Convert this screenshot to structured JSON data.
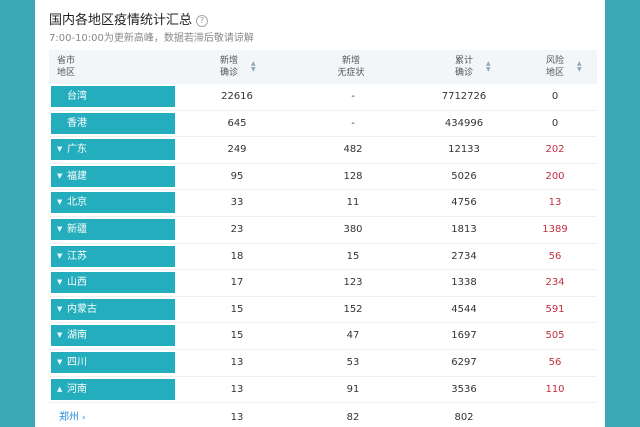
{
  "title": "国内各地区疫情统计汇总",
  "subtitle": "7:00-10:00为更新高峰，数据若滞后敬请谅解",
  "headers": {
    "region": "省市\n地区",
    "new_confirmed": "新增\n确诊",
    "new_asymptomatic": "新增\n无症状",
    "total_confirmed": "累计\n确诊",
    "risk": "风险\n地区"
  },
  "rows": [
    {
      "name": "台湾",
      "expand": "",
      "new_confirmed": "22616",
      "new_asymptomatic": "-",
      "total": "7712726",
      "risk": "0",
      "risk_alert": false
    },
    {
      "name": "香港",
      "expand": "",
      "new_confirmed": "645",
      "new_asymptomatic": "-",
      "total": "434996",
      "risk": "0",
      "risk_alert": false
    },
    {
      "name": "广东",
      "expand": "▼",
      "new_confirmed": "249",
      "new_asymptomatic": "482",
      "total": "12133",
      "risk": "202",
      "risk_alert": true
    },
    {
      "name": "福建",
      "expand": "▼",
      "new_confirmed": "95",
      "new_asymptomatic": "128",
      "total": "5026",
      "risk": "200",
      "risk_alert": true
    },
    {
      "name": "北京",
      "expand": "▼",
      "new_confirmed": "33",
      "new_asymptomatic": "11",
      "total": "4756",
      "risk": "13",
      "risk_alert": true
    },
    {
      "name": "新疆",
      "expand": "▼",
      "new_confirmed": "23",
      "new_asymptomatic": "380",
      "total": "1813",
      "risk": "1389",
      "risk_alert": true
    },
    {
      "name": "江苏",
      "expand": "▼",
      "new_confirmed": "18",
      "new_asymptomatic": "15",
      "total": "2734",
      "risk": "56",
      "risk_alert": true
    },
    {
      "name": "山西",
      "expand": "▼",
      "new_confirmed": "17",
      "new_asymptomatic": "123",
      "total": "1338",
      "risk": "234",
      "risk_alert": true
    },
    {
      "name": "内蒙古",
      "expand": "▼",
      "new_confirmed": "15",
      "new_asymptomatic": "152",
      "total": "4544",
      "risk": "591",
      "risk_alert": true
    },
    {
      "name": "湖南",
      "expand": "▼",
      "new_confirmed": "15",
      "new_asymptomatic": "47",
      "total": "1697",
      "risk": "505",
      "risk_alert": true
    },
    {
      "name": "四川",
      "expand": "▼",
      "new_confirmed": "13",
      "new_asymptomatic": "53",
      "total": "6297",
      "risk": "56",
      "risk_alert": true
    },
    {
      "name": "河南",
      "expand": "▲",
      "new_confirmed": "13",
      "new_asymptomatic": "91",
      "total": "3536",
      "risk": "110",
      "risk_alert": true
    }
  ],
  "sub_row": {
    "name": "郑州",
    "new_confirmed": "13",
    "new_asymptomatic": "82",
    "total": "802",
    "risk": ""
  },
  "colors": {
    "button": "#24adbd",
    "risk_red": "#c0313e",
    "link": "#1f8fe0",
    "background": "#3aa9b4"
  }
}
